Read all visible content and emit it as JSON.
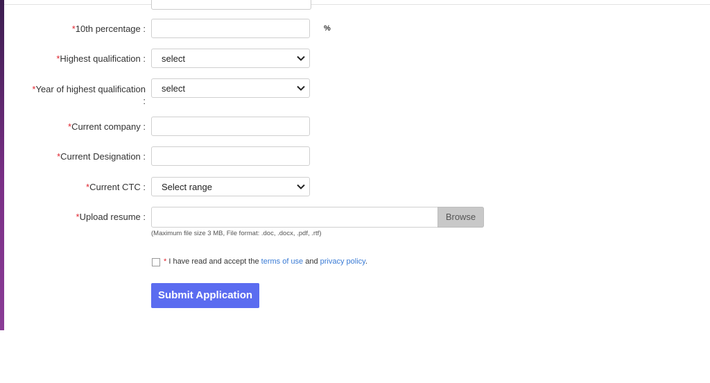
{
  "form": {
    "fields": [
      {
        "id": "tenth",
        "label": "10th percentage :",
        "required_mark": "*",
        "type": "text",
        "unit": "%",
        "value": ""
      },
      {
        "id": "highest_qualification",
        "label": "Highest qualification :",
        "required_mark": "*",
        "type": "select",
        "selected": "select"
      },
      {
        "id": "year_highest_qualification",
        "label_line1": "Year of highest qualification",
        "label_line2": ":",
        "required_mark": "*",
        "type": "select",
        "selected": "select"
      },
      {
        "id": "current_company",
        "label": "Current company :",
        "required_mark": "*",
        "type": "text",
        "value": ""
      },
      {
        "id": "current_designation",
        "label": "Current Designation :",
        "required_mark": "*",
        "type": "text",
        "value": ""
      },
      {
        "id": "current_ctc",
        "label": "Current CTC :",
        "required_mark": "*",
        "type": "select",
        "selected": "Select range"
      },
      {
        "id": "resume",
        "label": "Upload resume :",
        "required_mark": "*",
        "type": "file",
        "button": "Browse",
        "hint": "(Maximum file size 3 MB, File format: .doc, .docx, .pdf, .rtf)"
      }
    ],
    "consent": {
      "required_mark": "*",
      "text_before": " I have read and accept the ",
      "terms_link": "terms of use",
      "text_middle": " and ",
      "privacy_link": "privacy policy",
      "text_after": "."
    },
    "submit_label": "Submit Application"
  },
  "colors": {
    "required": "#e0252f",
    "submit_bg": "#5b6cf0",
    "link": "#3a7bd5",
    "sidebar_accent": "#7a2f86"
  },
  "icons": {
    "select_arrow": "chevron-down-icon",
    "checkbox": "checkbox-unchecked"
  }
}
